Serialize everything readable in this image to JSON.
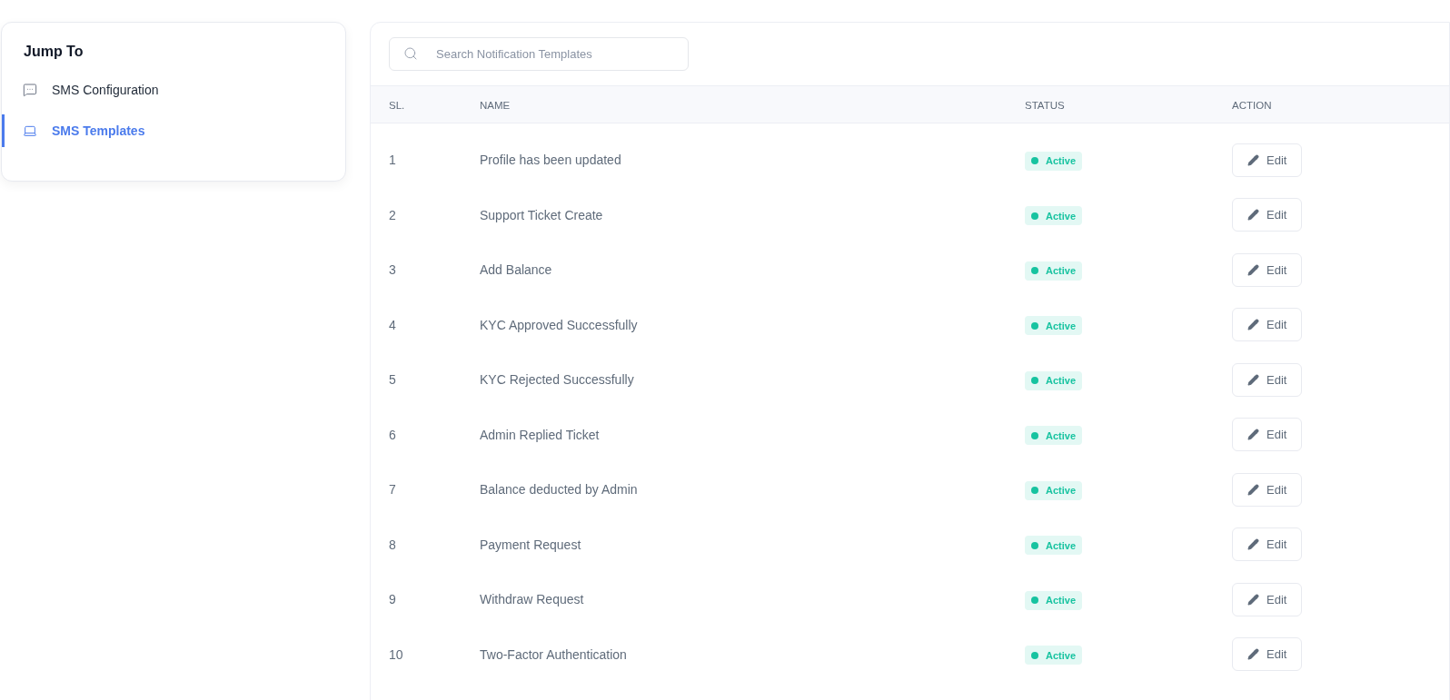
{
  "sidebar": {
    "title": "Jump To",
    "items": [
      {
        "label": "SMS Configuration",
        "kind": "chat",
        "selected": false
      },
      {
        "label": "SMS Templates",
        "kind": "laptop",
        "selected": true
      }
    ]
  },
  "search": {
    "placeholder": "Search Notification Templates"
  },
  "table": {
    "columns": [
      "SL.",
      "NAME",
      "STATUS",
      "ACTION"
    ],
    "rows": [
      {
        "sl": "1",
        "name": "Profile has been updated",
        "status": "Active",
        "action": "Edit"
      },
      {
        "sl": "2",
        "name": "Support Ticket Create",
        "status": "Active",
        "action": "Edit"
      },
      {
        "sl": "3",
        "name": "Add Balance",
        "status": "Active",
        "action": "Edit"
      },
      {
        "sl": "4",
        "name": "KYC Approved Successfully",
        "status": "Active",
        "action": "Edit"
      },
      {
        "sl": "5",
        "name": "KYC Rejected Successfully",
        "status": "Active",
        "action": "Edit"
      },
      {
        "sl": "6",
        "name": "Admin Replied Ticket",
        "status": "Active",
        "action": "Edit"
      },
      {
        "sl": "7",
        "name": "Balance deducted by Admin",
        "status": "Active",
        "action": "Edit"
      },
      {
        "sl": "8",
        "name": "Payment Request",
        "status": "Active",
        "action": "Edit"
      },
      {
        "sl": "9",
        "name": "Withdraw Request",
        "status": "Active",
        "action": "Edit"
      },
      {
        "sl": "10",
        "name": "Two-Factor Authentication",
        "status": "Active",
        "action": "Edit"
      }
    ]
  }
}
